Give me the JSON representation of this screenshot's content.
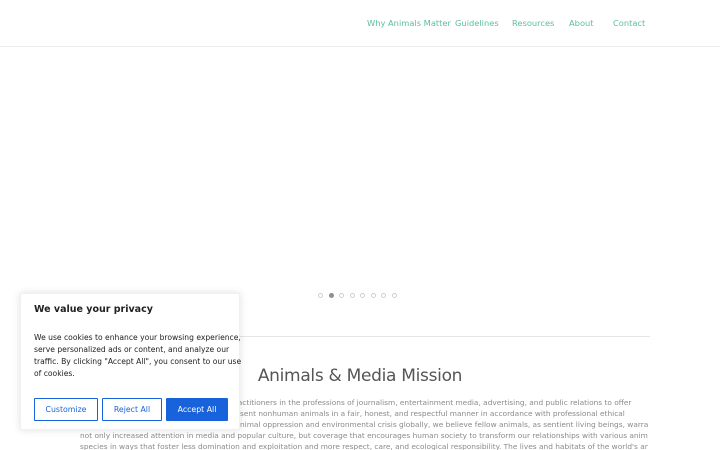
{
  "nav": {
    "items": [
      {
        "label": "Why Animals Matter"
      },
      {
        "label": "Guidelines"
      },
      {
        "label": "Resources"
      },
      {
        "label": "About"
      },
      {
        "label": "Contact"
      }
    ]
  },
  "slider": {
    "slide_count": 8,
    "active_index": 1
  },
  "mission": {
    "title": "Animals & Media Mission",
    "lines": [
      "practitioners in the professions of journalism, entertainment media, advertising, and public relations to offer",
      "sent nonhuman animals in a fair, honest, and respectful manner in accordance with professional ethical",
      "nimal oppression and environmental crisis globally, we believe fellow animals, as sentient living beings, warrant",
      "not only increased attention in media and popular culture, but coverage that encourages human society to transform our relationships with various animal",
      "species in ways that foster less domination and exploitation and more respect, care, and ecological responsibility. The lives and habitats of the world's animals"
    ]
  },
  "cookie_banner": {
    "title": "We value your privacy",
    "body_lines": [
      "We use cookies to enhance your browsing experience,",
      "serve personalized ads or content, and analyze our",
      "traffic. By clicking \"Accept All\", you consent to our use",
      "of cookies."
    ],
    "customize_label": "Customize",
    "reject_label": "Reject All",
    "accept_label": "Accept All"
  },
  "colors": {
    "nav_link": "#5bbf9a",
    "cookie_accent": "#1863dc"
  }
}
